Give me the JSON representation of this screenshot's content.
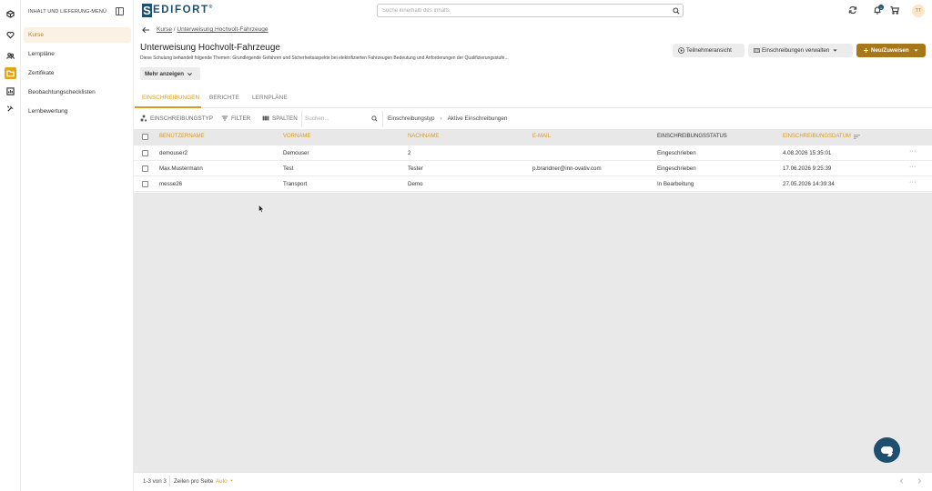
{
  "brand": {
    "name": "EDIFORT",
    "mark": "S",
    "mark_reg": "®"
  },
  "search": {
    "placeholder": "Suche innerhalb des Inhalts"
  },
  "notifications": {
    "count": "1"
  },
  "user": {
    "initials": "TT"
  },
  "menu": {
    "title": "INHALT UND LIEFERUNG-MENÜ",
    "items": [
      {
        "label": "Kurse",
        "active": true
      },
      {
        "label": "Lernpläne"
      },
      {
        "label": "Zertifikate"
      },
      {
        "label": "Beobachtungschecklisten"
      },
      {
        "label": "Lernbewertung"
      }
    ]
  },
  "breadcrumb": {
    "root": "Kurse",
    "separator": "/",
    "current": "Unterweisung Hochvolt-Fahrzeuge"
  },
  "course": {
    "title": "Unterweisung Hochvolt-Fahrzeuge",
    "description": "Diese Schulung behandelt folgende Themen: Grundlegende Gefahren und Sicherheitsaspekte bei elektrifizierten Fahrzeugen Bedeutung und Anforderungen der Qualifizierungsstufe...",
    "more_label": "Mehr anzeigen"
  },
  "actions": {
    "participant_view": "Teilnehmeransicht",
    "manage_enrollments": "Einschreibungen verwalten",
    "new_assign": "Neu/Zuweisen"
  },
  "tabs": [
    {
      "label": "EINSCHREIBUNGEN",
      "active": true
    },
    {
      "label": "BERICHTE"
    },
    {
      "label": "LERNPLÄNE"
    }
  ],
  "toolbar": {
    "enrollment_type": "EINSCHREIBUNGSTYP",
    "filter": "FILTER",
    "columns": "SPALTEN",
    "search_placeholder": "Suchen...",
    "path_root": "Einschreibungstyp",
    "path_sep": "›",
    "path_current": "Aktive Einschreibungen"
  },
  "table": {
    "columns": [
      "BENUTZERNAME",
      "VORNAME",
      "NACHNAME",
      "E-MAIL",
      "EINSCHREIBUNGSSTATUS",
      "EINSCHREIBUNGSDATUM"
    ],
    "rows": [
      {
        "username": "demouser2",
        "firstname": "Demouser",
        "lastname": "2",
        "email": "",
        "status": "Eingeschrieben",
        "date": "4.08.2026 15:35:01",
        "more": "···"
      },
      {
        "username": "Max.Mustermann",
        "firstname": "Test",
        "lastname": "Tester",
        "email": "p.brandner@inn-ovativ.com",
        "status": "Eingeschrieben",
        "date": "17.06.2026 9:25:39",
        "more": "···"
      },
      {
        "username": "messe26",
        "firstname": "Transport",
        "lastname": "Demo",
        "email": "",
        "status": "In Bearbeitung",
        "date": "27.05.2026 14:39:34",
        "more": "···"
      }
    ]
  },
  "footer": {
    "range": "1-3 von 3",
    "rows_per_page": "Zeilen pro Seite",
    "rows_value": "Auto"
  },
  "colors": {
    "accent": "#d79b24",
    "primary_button": "#a7771b",
    "brand": "#1f4f6e"
  }
}
